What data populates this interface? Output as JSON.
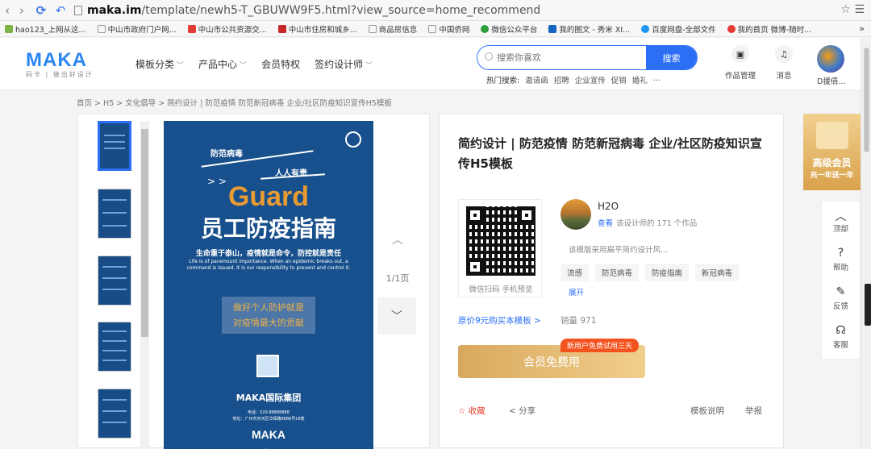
{
  "browser": {
    "url_host": "maka.im",
    "url_path": "/template/newh5-T_GBUWW9F5.html?view_source=home_recommend",
    "bookmarks": [
      "hao123_上网从这...",
      "中山市政府门户网...",
      "中山市公共资源交...",
      "中山市住房和城乡...",
      "商品房信息",
      "中国侨网",
      "微信公众平台",
      "我的图文 - 秀米 XI...",
      "百度网盘-全部文件",
      "我的首页 微博-随时..."
    ],
    "bookmark_more": "»"
  },
  "header": {
    "logo": "MAKA",
    "logo_sub": "码卡 | 做出好设计",
    "nav": [
      "模板分类",
      "产品中心",
      "会员特权",
      "签约设计师"
    ],
    "search_placeholder": "搜索你喜欢",
    "search_button": "搜索",
    "hot_label": "热门搜索:",
    "hot": [
      "邀请函",
      "招聘",
      "企业宣传",
      "促销",
      "婚礼",
      "..."
    ],
    "tools": [
      "作品管理",
      "消息"
    ],
    "user": "D援倩..."
  },
  "breadcrumb": "首页 > H5 > 文化倡导 > 简约设计 | 防范疫情 防范新冠病毒 企业/社区防疫知识宣传H5模板",
  "poster": {
    "tag1": "防范病毒",
    "tag2": "人人有责",
    "arrows": "> >",
    "guard": "Guard",
    "title": "员工防疫指南",
    "cn_line": "生命重于泰山，疫情就是命令，防控就是责任",
    "en_line": "Life is of paramount importance. When an epidemic breaks out, a command is issued. It is our responsibility to prevent and control it.",
    "box_line1": "做好个人防护就是",
    "box_line2": "对疫情最大的贡献",
    "company": "MAKA国际集团",
    "tel": "电话：020-88888888",
    "address": "地址：广州市天河区华晖路8888号18楼",
    "brand": "MAKA"
  },
  "pager": {
    "count": "1/1页"
  },
  "info": {
    "title": "简约设计 | 防范疫情 防范新冠病毒 企业/社区防疫知识宣传H5模板",
    "qr_caption": "微信扫码 手机预览",
    "designer_name": "H2O",
    "designer_view": "查看",
    "designer_works": "该设计师的 171 个作品",
    "desc": "该模版采用扁平简约设计风...",
    "tags": [
      "流感",
      "防范病毒",
      "防疫指南",
      "新冠病毒"
    ],
    "expand": "展开",
    "buy_link": "原价9元购买本模板 >",
    "sales": "销量 971",
    "cta": "会员免费用",
    "cta_badge": "新用户免费试用三天",
    "fav": "☆ 收藏",
    "share": "< 分享",
    "guide": "模板说明",
    "report": "举报"
  },
  "vip": {
    "line1": "高级会员",
    "line2": "充一年送一年"
  },
  "side_tools": [
    "顶部",
    "帮助",
    "反馈",
    "客服"
  ]
}
